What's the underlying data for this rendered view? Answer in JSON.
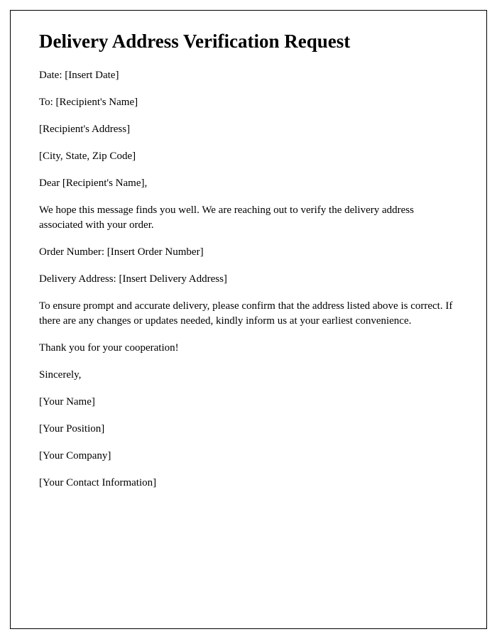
{
  "title": "Delivery Address Verification Request",
  "lines": {
    "date": "Date: [Insert Date]",
    "to": "To: [Recipient's Name]",
    "recipient_address": "[Recipient's Address]",
    "city_state_zip": "[City, State, Zip Code]",
    "salutation": "Dear [Recipient's Name],",
    "intro": "We hope this message finds you well. We are reaching out to verify the delivery address associated with your order.",
    "order_number": "Order Number: [Insert Order Number]",
    "delivery_address": "Delivery Address: [Insert Delivery Address]",
    "request": "To ensure prompt and accurate delivery, please confirm that the address listed above is correct. If there are any changes or updates needed, kindly inform us at your earliest convenience.",
    "thanks": "Thank you for your cooperation!",
    "closing": "Sincerely,",
    "your_name": "[Your Name]",
    "your_position": "[Your Position]",
    "your_company": "[Your Company]",
    "your_contact": "[Your Contact Information]"
  }
}
